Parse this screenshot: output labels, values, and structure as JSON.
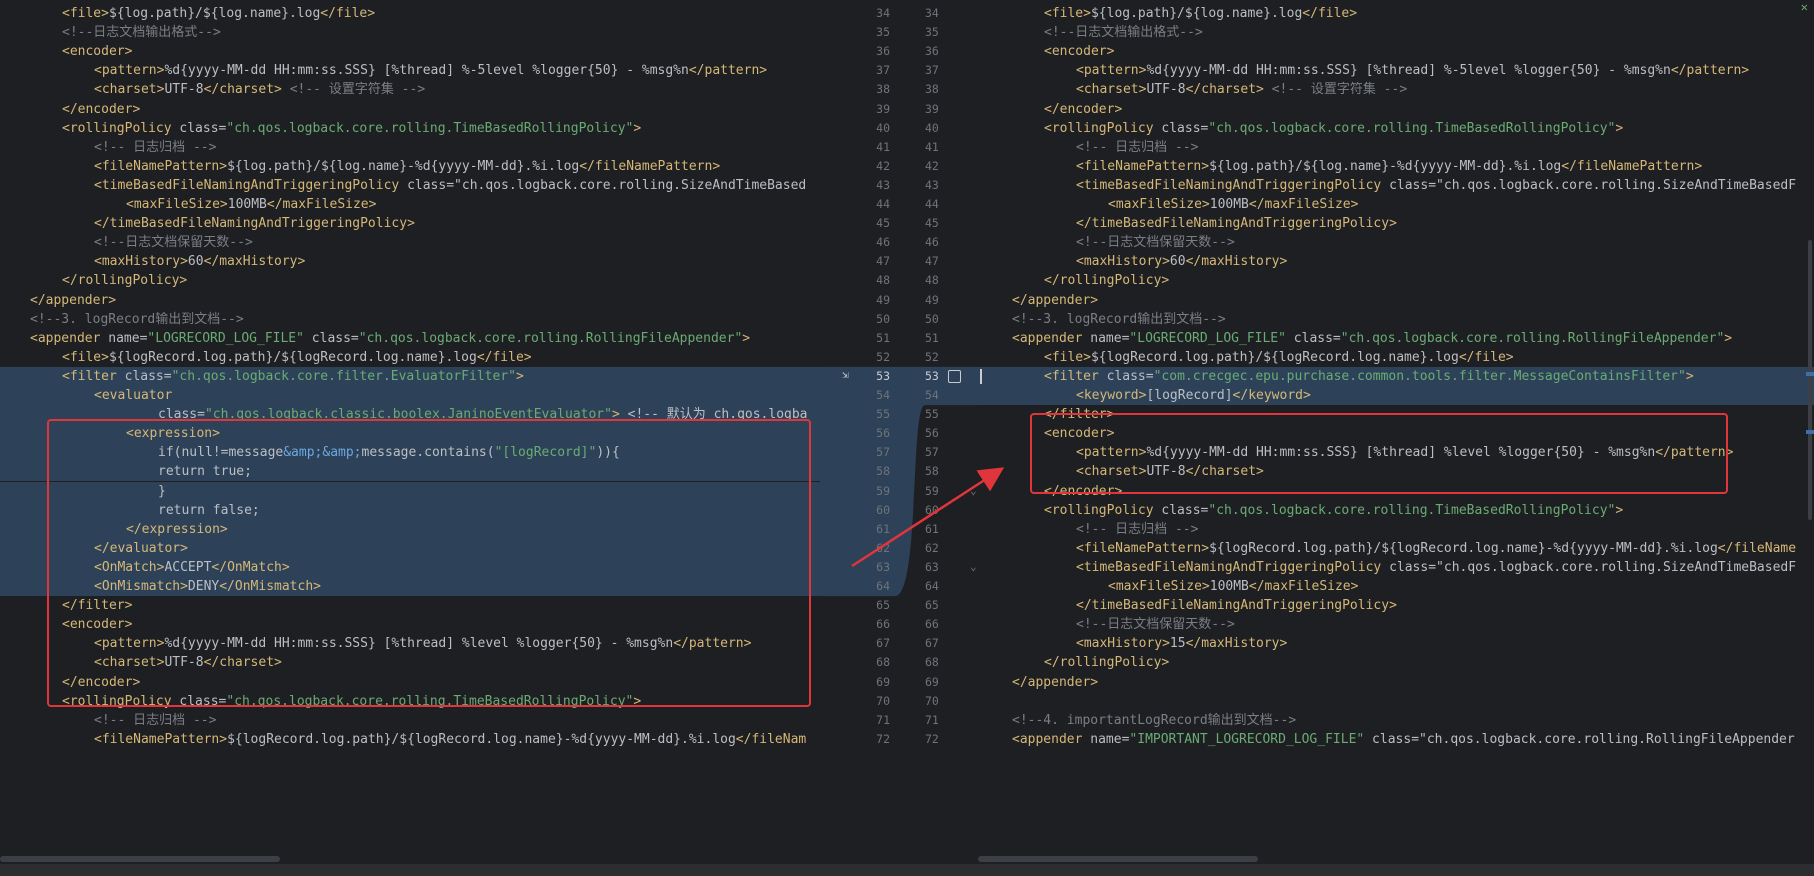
{
  "gutter_numbers": [
    {
      "left": "34",
      "right": "34"
    },
    {
      "left": "35",
      "right": "35"
    },
    {
      "left": "36",
      "right": "36"
    },
    {
      "left": "37",
      "right": "37"
    },
    {
      "left": "38",
      "right": "38"
    },
    {
      "left": "39",
      "right": "39"
    },
    {
      "left": "40",
      "right": "40"
    },
    {
      "left": "41",
      "right": "41"
    },
    {
      "left": "42",
      "right": "42"
    },
    {
      "left": "43",
      "right": "43"
    },
    {
      "left": "44",
      "right": "44"
    },
    {
      "left": "45",
      "right": "45"
    },
    {
      "left": "46",
      "right": "46"
    },
    {
      "left": "47",
      "right": "47"
    },
    {
      "left": "48",
      "right": "48"
    },
    {
      "left": "49",
      "right": "49"
    },
    {
      "left": "50",
      "right": "50"
    },
    {
      "left": "51",
      "right": "51"
    },
    {
      "left": "52",
      "right": "52"
    },
    {
      "left": "53",
      "right": "53"
    },
    {
      "left": "54",
      "right": ""
    },
    {
      "left": "55",
      "right": ""
    },
    {
      "left": "56",
      "right": ""
    },
    {
      "left": "57",
      "right": ""
    },
    {
      "left": "58",
      "right": ""
    },
    {
      "left": "59",
      "right": ""
    },
    {
      "left": "60",
      "right": ""
    },
    {
      "left": "61",
      "right": ""
    },
    {
      "left": "62",
      "right": ""
    },
    {
      "left": "63",
      "right": ""
    },
    {
      "left": "64",
      "right": ""
    },
    {
      "left": "65",
      "right": ""
    },
    {
      "left": "66",
      "right": ""
    },
    {
      "left": "67",
      "right": ""
    },
    {
      "left": "68",
      "right": ""
    },
    {
      "left": "69",
      "right": ""
    },
    {
      "left": "70",
      "right": ""
    },
    {
      "left": "71",
      "right": ""
    },
    {
      "left": "72",
      "right": ""
    }
  ],
  "right_gutter_numbers": [
    "34",
    "35",
    "36",
    "37",
    "38",
    "39",
    "40",
    "41",
    "42",
    "43",
    "44",
    "45",
    "46",
    "47",
    "48",
    "49",
    "50",
    "51",
    "52",
    "53",
    "54",
    "55",
    "56",
    "57",
    "58",
    "59",
    "60",
    "61",
    "62",
    "63",
    "64",
    "65",
    "66",
    "67",
    "68",
    "69",
    "70",
    "71",
    "72"
  ],
  "left_lines": [
    {
      "indent": 1,
      "text": "<file>${log.path}/${log.name}.log</file>"
    },
    {
      "indent": 1,
      "text": "<!--日志文档输出格式-->"
    },
    {
      "indent": 1,
      "text": "<encoder>"
    },
    {
      "indent": 2,
      "text": "<pattern>%d{yyyy-MM-dd HH:mm:ss.SSS} [%thread] %-5level %logger{50} - %msg%n</pattern>"
    },
    {
      "indent": 2,
      "text": "<charset>UTF-8</charset> <!-- 设置字符集 -->"
    },
    {
      "indent": 1,
      "text": "</encoder>"
    },
    {
      "indent": 1,
      "text": "<rollingPolicy class=\"ch.qos.logback.core.rolling.TimeBasedRollingPolicy\">"
    },
    {
      "indent": 2,
      "text": "<!-- 日志归档 -->"
    },
    {
      "indent": 2,
      "text": "<fileNamePattern>${log.path}/${log.name}-%d{yyyy-MM-dd}.%i.log</fileNamePattern>"
    },
    {
      "indent": 2,
      "text": "<timeBasedFileNamingAndTriggeringPolicy class=\"ch.qos.logback.core.rolling.SizeAndTimeBased"
    },
    {
      "indent": 3,
      "text": "<maxFileSize>100MB</maxFileSize>"
    },
    {
      "indent": 2,
      "text": "</timeBasedFileNamingAndTriggeringPolicy>"
    },
    {
      "indent": 2,
      "text": "<!--日志文档保留天数-->"
    },
    {
      "indent": 2,
      "text": "<maxHistory>60</maxHistory>"
    },
    {
      "indent": 1,
      "text": "</rollingPolicy>"
    },
    {
      "indent": 0,
      "text": "</appender>"
    },
    {
      "indent": 0,
      "text": "<!--3. logRecord输出到文档-->"
    },
    {
      "indent": 0,
      "text": "<appender name=\"LOGRECORD_LOG_FILE\" class=\"ch.qos.logback.core.rolling.RollingFileAppender\">"
    },
    {
      "indent": 1,
      "text": "<file>${logRecord.log.path}/${logRecord.log.name}.log</file>"
    },
    {
      "indent": 1,
      "text": "<filter class=\"ch.qos.logback.core.filter.EvaluatorFilter\">",
      "sel": true
    },
    {
      "indent": 2,
      "text": "<evaluator",
      "sel": true
    },
    {
      "indent": 4,
      "text": "class=\"ch.qos.logback.classic.boolex.JaninoEventEvaluator\"> <!-- 默认为 ch.qos.logba",
      "sel": true
    },
    {
      "indent": 3,
      "text": "<expression>",
      "sel": true
    },
    {
      "indent": 4,
      "text": "if(null!=message&amp;&amp;message.contains(\"[logRecord]\")){",
      "sel": true
    },
    {
      "indent": 4,
      "text": "return true;",
      "sel": true
    },
    {
      "indent": 4,
      "text": "}",
      "sel": true
    },
    {
      "indent": 4,
      "text": "return false;",
      "sel": true
    },
    {
      "indent": 3,
      "text": "</expression>",
      "sel": true
    },
    {
      "indent": 2,
      "text": "</evaluator>",
      "sel": true
    },
    {
      "indent": 2,
      "text": "<OnMatch>ACCEPT</OnMatch>",
      "sel": true
    },
    {
      "indent": 2,
      "text": "<OnMismatch>DENY</OnMismatch>",
      "sel": true
    },
    {
      "indent": 1,
      "text": "</filter>"
    },
    {
      "indent": 1,
      "text": "<encoder>"
    },
    {
      "indent": 2,
      "text": "<pattern>%d{yyyy-MM-dd HH:mm:ss.SSS} [%thread] %level %logger{50} - %msg%n</pattern>"
    },
    {
      "indent": 2,
      "text": "<charset>UTF-8</charset>"
    },
    {
      "indent": 1,
      "text": "</encoder>"
    },
    {
      "indent": 1,
      "text": "<rollingPolicy class=\"ch.qos.logback.core.rolling.TimeBasedRollingPolicy\">"
    },
    {
      "indent": 2,
      "text": "<!-- 日志归档 -->"
    },
    {
      "indent": 2,
      "text": "<fileNamePattern>${logRecord.log.path}/${logRecord.log.name}-%d{yyyy-MM-dd}.%i.log</fileNam"
    }
  ],
  "right_lines": [
    {
      "indent": 1,
      "text": "<file>${log.path}/${log.name}.log</file>"
    },
    {
      "indent": 1,
      "text": "<!--日志文档输出格式-->"
    },
    {
      "indent": 1,
      "text": "<encoder>"
    },
    {
      "indent": 2,
      "text": "<pattern>%d{yyyy-MM-dd HH:mm:ss.SSS} [%thread] %-5level %logger{50} - %msg%n</pattern>"
    },
    {
      "indent": 2,
      "text": "<charset>UTF-8</charset> <!-- 设置字符集 -->"
    },
    {
      "indent": 1,
      "text": "</encoder>"
    },
    {
      "indent": 1,
      "text": "<rollingPolicy class=\"ch.qos.logback.core.rolling.TimeBasedRollingPolicy\">"
    },
    {
      "indent": 2,
      "text": "<!-- 日志归档 -->"
    },
    {
      "indent": 2,
      "text": "<fileNamePattern>${log.path}/${log.name}-%d{yyyy-MM-dd}.%i.log</fileNamePattern>"
    },
    {
      "indent": 2,
      "text": "<timeBasedFileNamingAndTriggeringPolicy class=\"ch.qos.logback.core.rolling.SizeAndTimeBasedF"
    },
    {
      "indent": 3,
      "text": "<maxFileSize>100MB</maxFileSize>"
    },
    {
      "indent": 2,
      "text": "</timeBasedFileNamingAndTriggeringPolicy>"
    },
    {
      "indent": 2,
      "text": "<!--日志文档保留天数-->"
    },
    {
      "indent": 2,
      "text": "<maxHistory>60</maxHistory>"
    },
    {
      "indent": 1,
      "text": "</rollingPolicy>"
    },
    {
      "indent": 0,
      "text": "</appender>"
    },
    {
      "indent": 0,
      "text": "<!--3. logRecord输出到文档-->"
    },
    {
      "indent": 0,
      "text": "<appender name=\"LOGRECORD_LOG_FILE\" class=\"ch.qos.logback.core.rolling.RollingFileAppender\">"
    },
    {
      "indent": 1,
      "text": "<file>${logRecord.log.path}/${logRecord.log.name}.log</file>"
    },
    {
      "indent": 1,
      "text": "<filter class=\"com.crecgec.epu.purchase.common.tools.filter.MessageContainsFilter\">",
      "sel": true
    },
    {
      "indent": 2,
      "text": "<keyword>[logRecord]</keyword>",
      "sel": true
    },
    {
      "indent": 1,
      "text": "</filter>"
    },
    {
      "indent": 1,
      "text": "<encoder>"
    },
    {
      "indent": 2,
      "text": "<pattern>%d{yyyy-MM-dd HH:mm:ss.SSS} [%thread] %level %logger{50} - %msg%n</pattern>"
    },
    {
      "indent": 2,
      "text": "<charset>UTF-8</charset>"
    },
    {
      "indent": 1,
      "text": "</encoder>"
    },
    {
      "indent": 1,
      "text": "<rollingPolicy class=\"ch.qos.logback.core.rolling.TimeBasedRollingPolicy\">"
    },
    {
      "indent": 2,
      "text": "<!-- 日志归档 -->"
    },
    {
      "indent": 2,
      "text": "<fileNamePattern>${logRecord.log.path}/${logRecord.log.name}-%d{yyyy-MM-dd}.%i.log</fileName"
    },
    {
      "indent": 2,
      "text": "<timeBasedFileNamingAndTriggeringPolicy class=\"ch.qos.logback.core.rolling.SizeAndTimeBasedF"
    },
    {
      "indent": 3,
      "text": "<maxFileSize>100MB</maxFileSize>"
    },
    {
      "indent": 2,
      "text": "</timeBasedFileNamingAndTriggeringPolicy>"
    },
    {
      "indent": 2,
      "text": "<!--日志文档保留天数-->"
    },
    {
      "indent": 2,
      "text": "<maxHistory>15</maxHistory>"
    },
    {
      "indent": 1,
      "text": "</rollingPolicy>"
    },
    {
      "indent": 0,
      "text": "</appender>"
    },
    {
      "indent": 0,
      "text": ""
    },
    {
      "indent": 0,
      "text": "<!--4. importantLogRecord输出到文档-->"
    },
    {
      "indent": 0,
      "text": "<appender name=\"IMPORTANT_LOGRECORD_LOG_FILE\" class=\"ch.qos.logback.core.rolling.RollingFileAppender"
    }
  ],
  "colors": {
    "background": "#1e1f22",
    "selection": "#2d4258",
    "annotation_red": "#e0353a",
    "tag": "#d5b778",
    "string": "#6aab73",
    "comment": "#7a7e85"
  },
  "icons": {
    "fold_marker": "chevron-down-icon",
    "accept_checkbox": "checkbox-icon",
    "close": "close-icon"
  }
}
